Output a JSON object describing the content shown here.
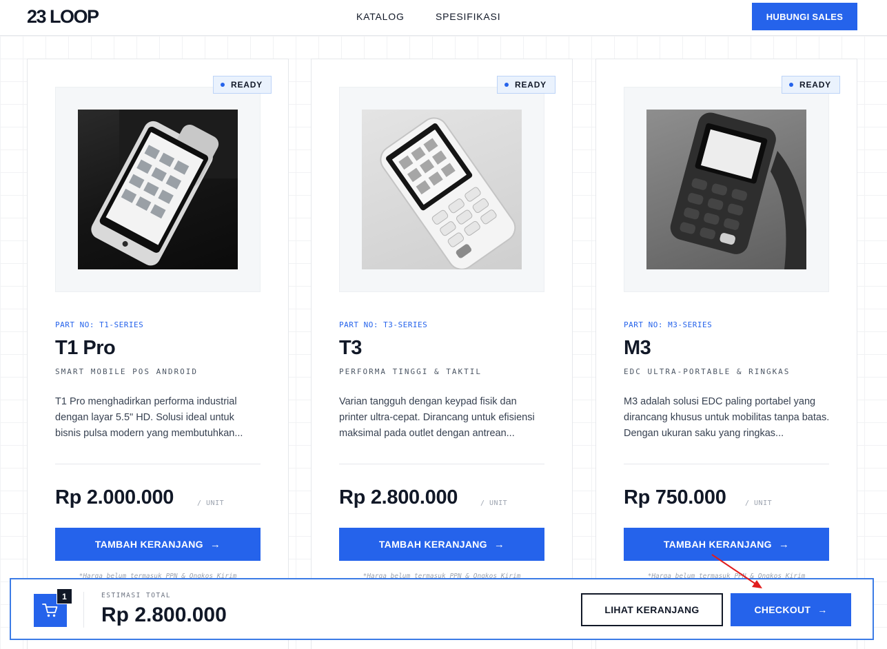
{
  "header": {
    "logo": "23 LOOP",
    "nav": [
      "KATALOG",
      "SPESIFIKASI"
    ],
    "cta": "HUBUNGI SALES"
  },
  "products": [
    {
      "badge": "READY",
      "part_no": "PART NO: T1-SERIES",
      "name": "T1 Pro",
      "tagline": "SMART MOBILE POS ANDROID",
      "description": "T1 Pro menghadirkan performa industrial dengan layar 5.5\" HD. Solusi ideal untuk bisnis pulsa modern yang membutuhkan...",
      "price": "Rp 2.000.000",
      "unit": "/ UNIT",
      "button": "TAMBAH KERANJANG",
      "note": "*Harga belum termasuk PPN & Ongkos Kirim"
    },
    {
      "badge": "READY",
      "part_no": "PART NO: T3-SERIES",
      "name": "T3",
      "tagline": "PERFORMA TINGGI & TAKTIL",
      "description": "Varian tangguh dengan keypad fisik dan printer ultra-cepat. Dirancang untuk efisiensi maksimal pada outlet dengan antrean...",
      "price": "Rp 2.800.000",
      "unit": "/ UNIT",
      "button": "TAMBAH KERANJANG",
      "note": "*Harga belum termasuk PPN & Ongkos Kirim"
    },
    {
      "badge": "READY",
      "part_no": "PART NO: M3-SERIES",
      "name": "M3",
      "tagline": "EDC ULTRA-PORTABLE & RINGKAS",
      "description": "M3 adalah solusi EDC paling portabel yang dirancang khusus untuk mobilitas tanpa batas. Dengan ukuran saku yang ringkas...",
      "price": "Rp 750.000",
      "unit": "/ UNIT",
      "button": "TAMBAH KERANJANG",
      "note": "*Harga belum termasuk PPN & Ongkos Kirim"
    }
  ],
  "cart": {
    "count": "1",
    "label": "ESTIMASI TOTAL",
    "total": "Rp 2.800.000",
    "view_cart": "LIHAT KERANJANG",
    "checkout": "CHECKOUT"
  },
  "colors": {
    "accent": "#2563eb",
    "dark": "#111827",
    "annotation": "#e11d1d"
  }
}
